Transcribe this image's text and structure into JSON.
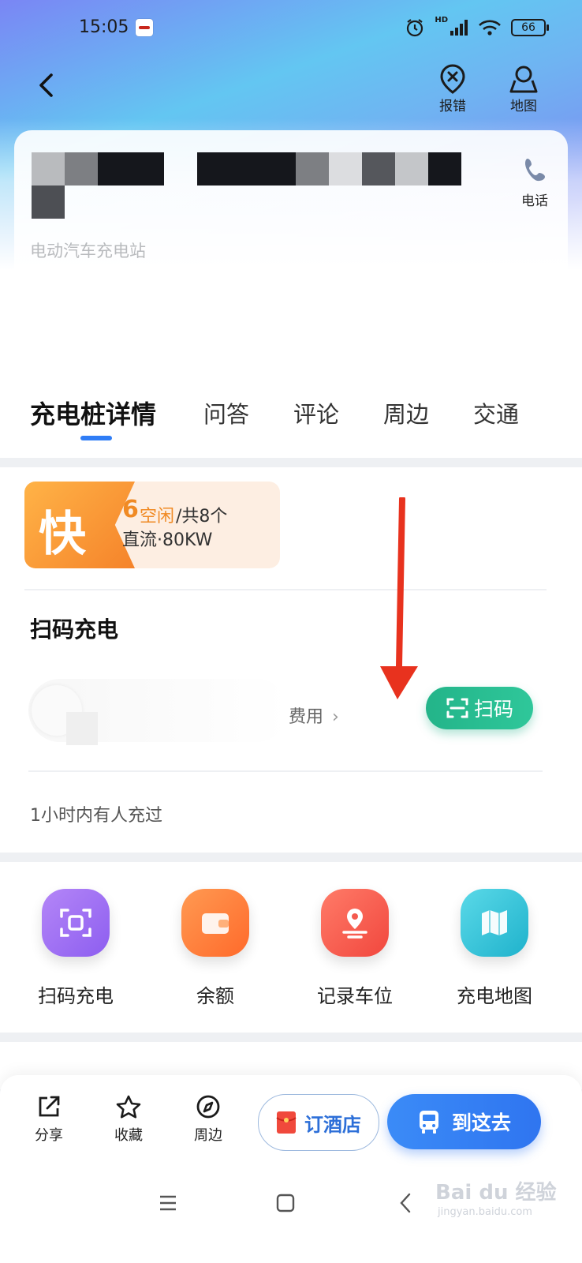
{
  "status_bar": {
    "time": "15:05",
    "battery": "66",
    "network": "HD"
  },
  "header": {
    "back_icon": "chevron-left-icon",
    "report_label": "报错",
    "map_label": "地图"
  },
  "station": {
    "type": "电动汽车充电站",
    "phone_label": "电话"
  },
  "tabs": [
    {
      "label": "充电桩详情",
      "active": true
    },
    {
      "label": "问答",
      "active": false
    },
    {
      "label": "评论",
      "active": false
    },
    {
      "label": "周边",
      "active": false
    },
    {
      "label": "交通",
      "active": false
    }
  ],
  "fast_charger": {
    "badge": "快",
    "free_count": "6",
    "free_label": "空闲",
    "total_label": "/共8个",
    "spec": "直流·80KW"
  },
  "scan_section": {
    "title": "扫码充电",
    "fee_link": "费用",
    "scan_button": "扫码",
    "note": "1小时内有人充过"
  },
  "shortcuts": [
    {
      "label": "扫码充电",
      "icon": "scan-icon",
      "color": "#9b6cf2"
    },
    {
      "label": "余额",
      "icon": "wallet-icon",
      "color": "#ff7a3d"
    },
    {
      "label": "记录车位",
      "icon": "location-pin-icon",
      "color": "#f45a4f"
    },
    {
      "label": "充电地图",
      "icon": "map-icon",
      "color": "#2fc2d6"
    }
  ],
  "bottom_bar": {
    "share_label": "分享",
    "favorite_label": "收藏",
    "nearby_label": "周边",
    "hotel_label": "订酒店",
    "go_label": "到这去"
  },
  "colors": {
    "accent_blue": "#2f7df6",
    "scan_green": "#23b489",
    "fast_orange": "#f5832a"
  },
  "watermark": {
    "main": "Bai du 经验",
    "sub": "jingyan.baidu.com"
  }
}
